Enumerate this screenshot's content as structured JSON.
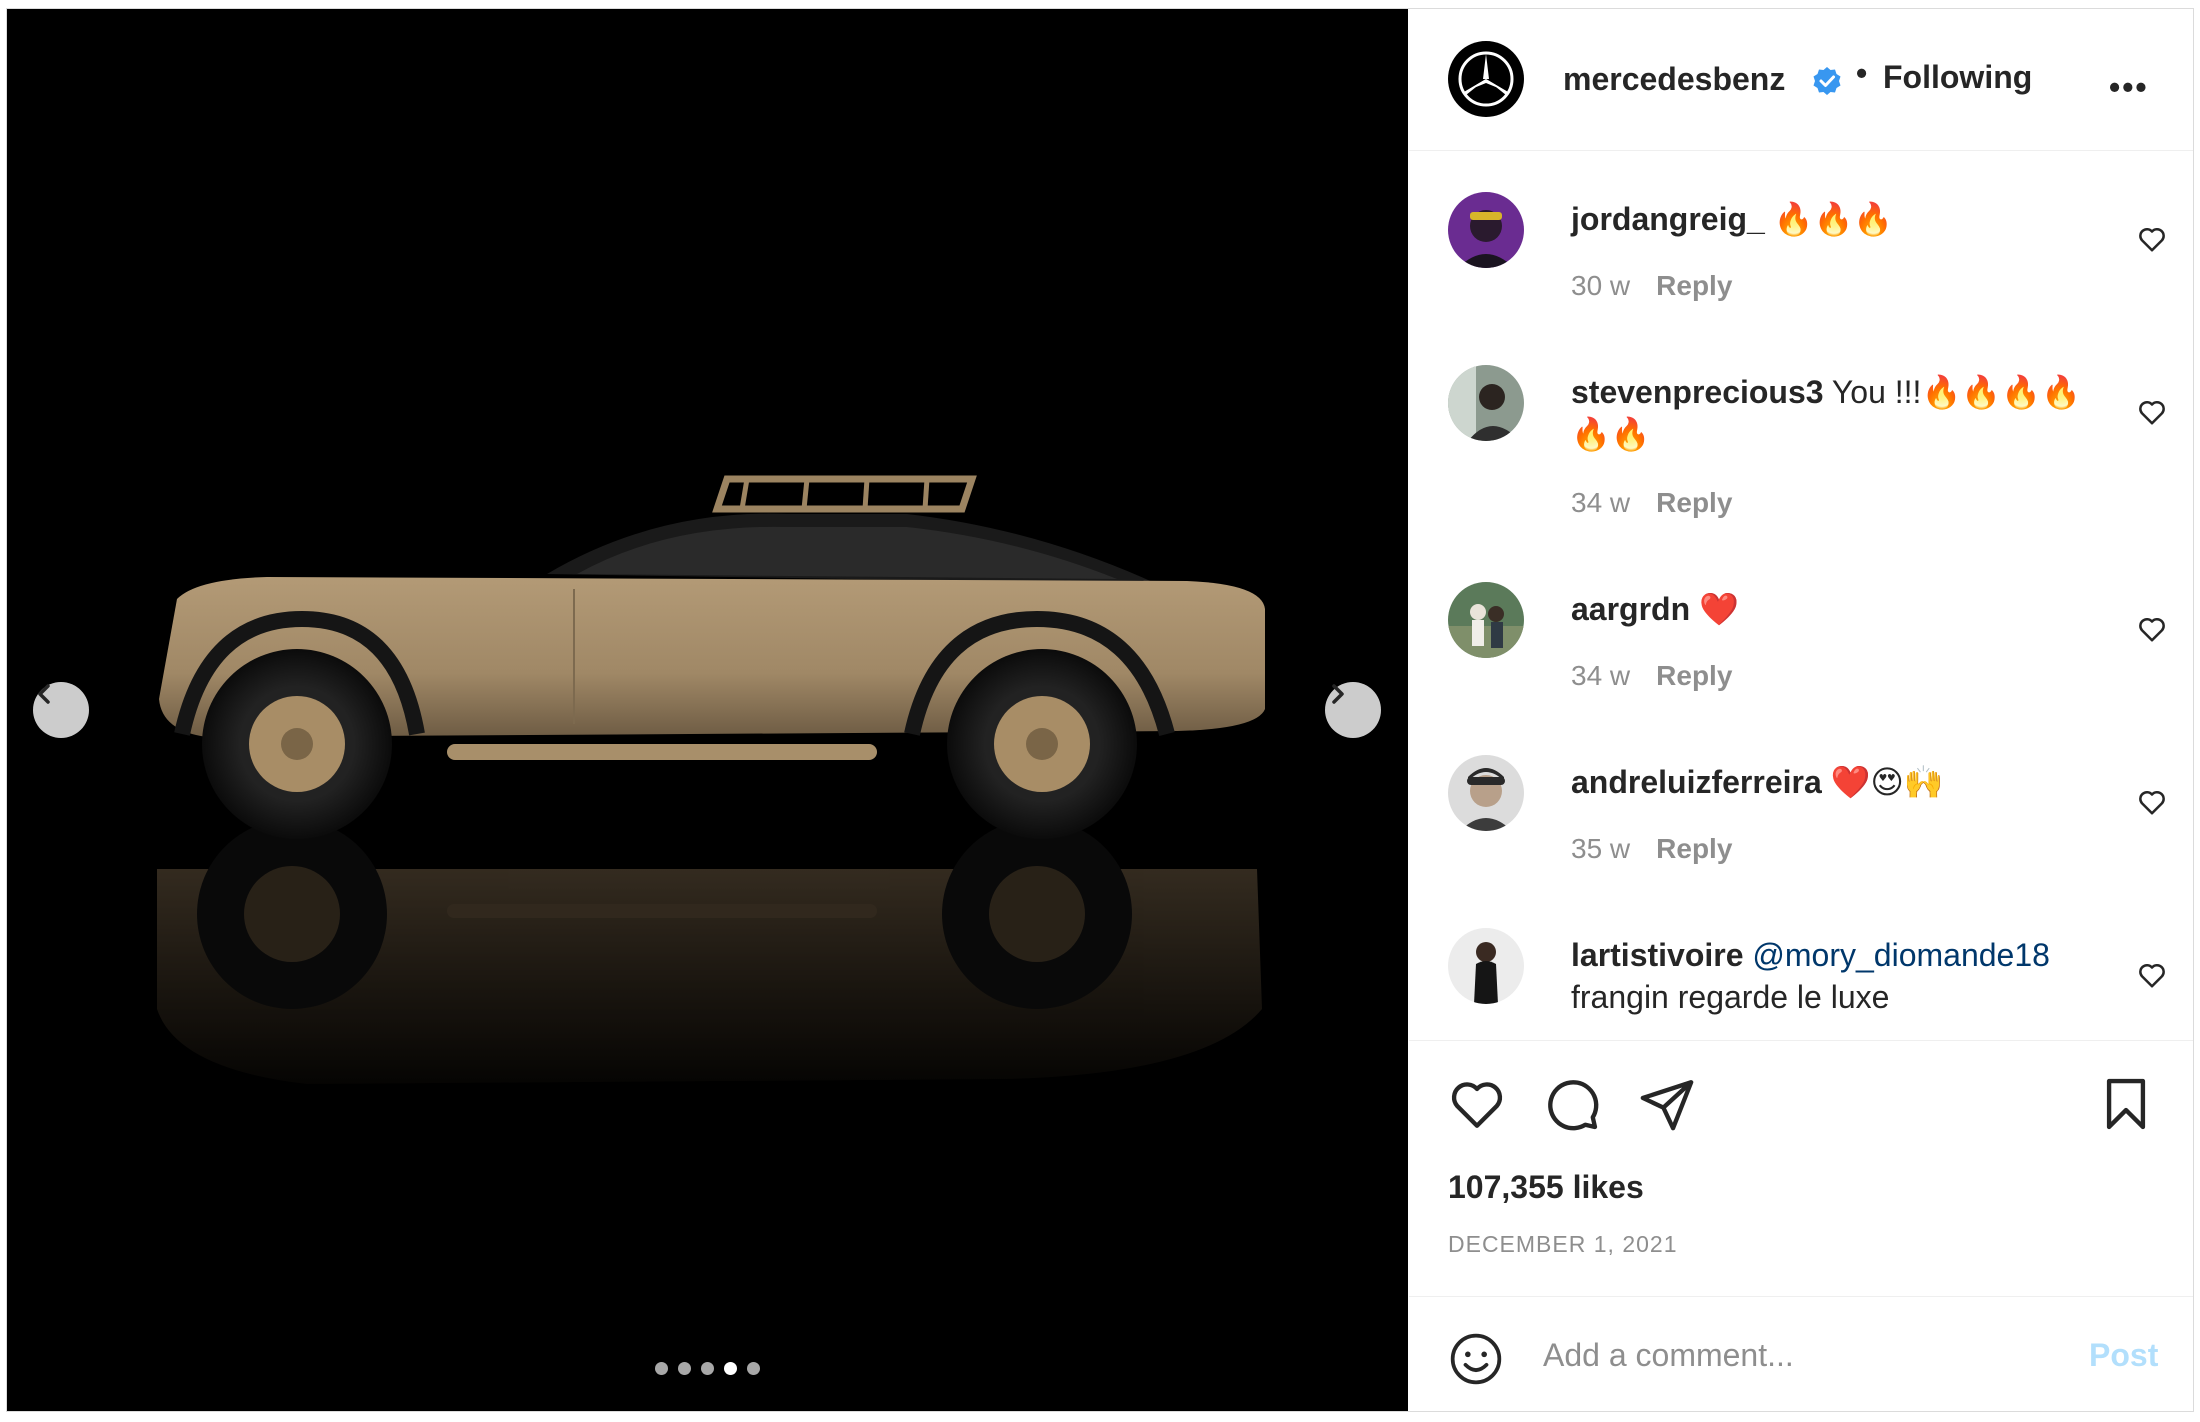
{
  "post": {
    "username": "mercedesbenz",
    "follow_state": "Following",
    "separator": "•",
    "more_label": "•••",
    "likes": "107,355 likes",
    "date": "DECEMBER 1, 2021",
    "carousel": {
      "count": 5,
      "active_index": 3
    }
  },
  "comments": [
    {
      "user": "jordangreig_",
      "text": "🔥🔥🔥",
      "mention": "",
      "age": "30 w",
      "reply": "Reply",
      "avatar_color": "#6a2c91"
    },
    {
      "user": "stevenprecious3",
      "text": "You !!!🔥🔥🔥🔥🔥🔥",
      "mention": "",
      "age": "34 w",
      "reply": "Reply",
      "avatar_color": "#8c9a8f"
    },
    {
      "user": "aargrdn",
      "text": "❤️",
      "mention": "",
      "age": "34 w",
      "reply": "Reply",
      "avatar_color": "#5b7a5a"
    },
    {
      "user": "andreluizferreira",
      "text": "❤️😍🙌",
      "mention": "",
      "age": "35 w",
      "reply": "Reply",
      "avatar_color": "#bdbdbd"
    },
    {
      "user": "lartistivoire",
      "text": "frangin regarde le luxe",
      "mention": "@mory_diomande18",
      "age": "",
      "reply": "",
      "avatar_color": "#e8e8e8"
    }
  ],
  "composer": {
    "placeholder": "Add a comment...",
    "post_label": "Post"
  },
  "colors": {
    "accent": "#0095f6",
    "verified": "#3897f0",
    "post_disabled": "#b2dffc",
    "car_body": "#a08866"
  }
}
